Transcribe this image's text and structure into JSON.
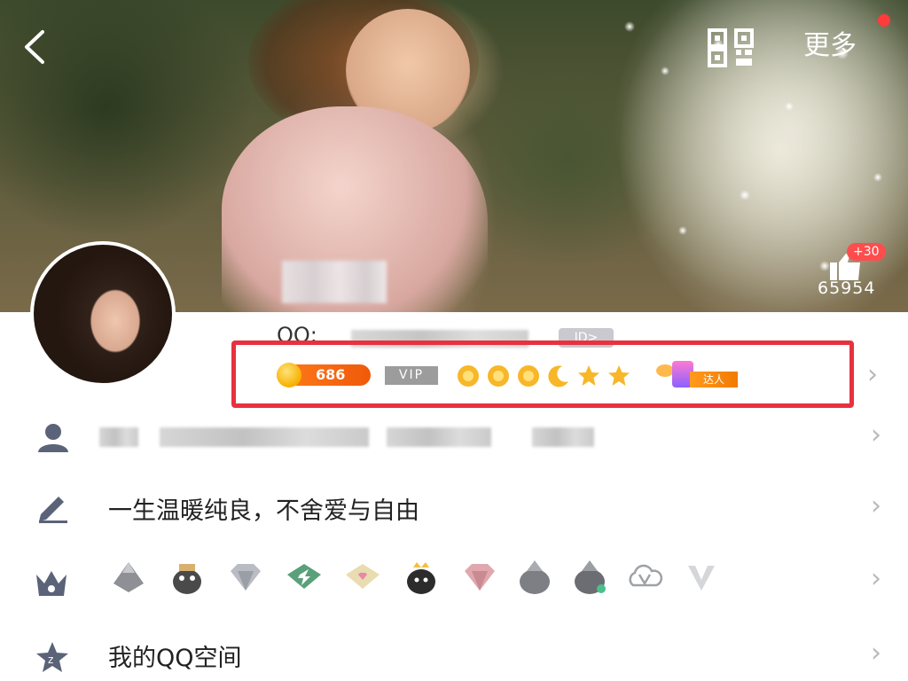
{
  "header": {
    "back_icon": "chevron-left-icon",
    "qr_icon": "qr-code-icon",
    "more_label": "更多",
    "notification_dot_color": "#ff3b3b"
  },
  "cover": {
    "likes_badge": "+30",
    "likes_count": "65954"
  },
  "profile": {
    "qq_label": "QQ:",
    "id_tag": "ID>"
  },
  "badges": {
    "coins": "686",
    "vip_label": "VIP",
    "level_icons": [
      "sun-icon",
      "sun-icon",
      "sun-icon",
      "moon-icon",
      "star-icon",
      "star-icon"
    ],
    "daren_label": "达人",
    "highlight_color": "#e8313f"
  },
  "rows": {
    "info_icon": "person-icon",
    "signature_icon": "pencil-icon",
    "signature": "一生温暖纯良，不舍爱与自由",
    "honors_icon": "crown-icon",
    "honor_icons": [
      "gray-penguin-icon",
      "penguin-icon",
      "diamond-icon",
      "green-diamond-icon",
      "pink-diamond-icon",
      "black-penguin-icon",
      "pink-gem-icon",
      "gray-penguin-icon",
      "gray-penguin-icon",
      "cloud-v-icon",
      "v-badge-icon"
    ],
    "qzone_icon": "star-z-icon",
    "qzone_label": "我的QQ空间"
  }
}
